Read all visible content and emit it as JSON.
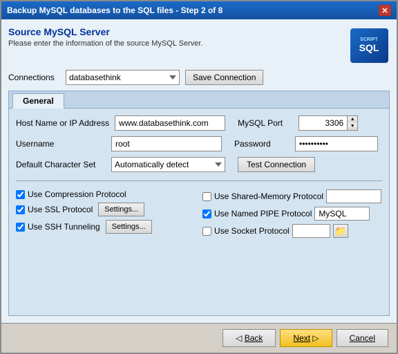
{
  "window": {
    "title": "Backup MySQL databases to the SQL files - Step 2 of 8",
    "close_btn": "✕"
  },
  "header": {
    "title": "Source MySQL Server",
    "subtitle": "Please enter the information of the source MySQL Server.",
    "logo_script": "SCRIPT",
    "logo_sql": "SQL"
  },
  "connections": {
    "label": "Connections",
    "value": "databasethink",
    "save_btn": "Save Connection"
  },
  "tabs": [
    {
      "label": "General",
      "active": true
    }
  ],
  "form": {
    "host_label": "Host Name or IP Address",
    "host_value": "www.databasethink.com",
    "port_label": "MySQL Port",
    "port_value": "3306",
    "username_label": "Username",
    "username_value": "root",
    "password_label": "Password",
    "password_value": "••••••••••",
    "charset_label": "Default Character Set",
    "charset_value": "Automatically detect",
    "test_conn_btn": "Test Connection"
  },
  "protocols": {
    "left": [
      {
        "id": "compression",
        "label": "Use Compression Protocol",
        "checked": true,
        "has_settings": false,
        "has_input": false,
        "has_folder": false
      },
      {
        "id": "ssl",
        "label": "Use SSL Protocol",
        "checked": true,
        "has_settings": true,
        "settings_label": "Settings...",
        "has_input": false,
        "has_folder": false
      },
      {
        "id": "ssh",
        "label": "Use SSH Tunneling",
        "checked": true,
        "has_settings": true,
        "settings_label": "Settings...",
        "has_input": false,
        "has_folder": false
      }
    ],
    "right": [
      {
        "id": "shared_memory",
        "label": "Use Shared-Memory Protocol",
        "checked": false,
        "has_input": true,
        "input_value": "",
        "has_folder": false
      },
      {
        "id": "named_pipe",
        "label": "Use Named PIPE Protocol",
        "checked": true,
        "has_input": true,
        "input_value": "MySQL",
        "has_folder": false
      },
      {
        "id": "socket",
        "label": "Use Socket Protocol",
        "checked": false,
        "has_input": false,
        "has_folder": true
      }
    ]
  },
  "footer": {
    "back_btn": "Back",
    "next_btn": "Next",
    "cancel_btn": "Cancel"
  }
}
